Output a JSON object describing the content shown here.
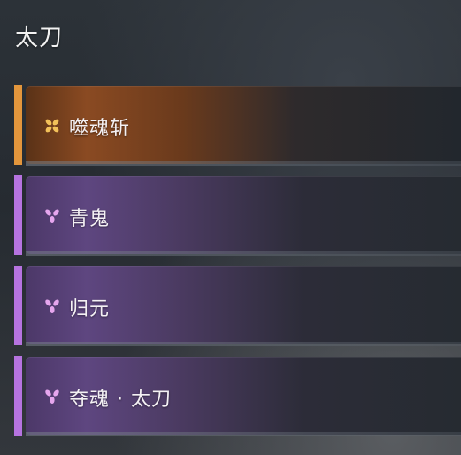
{
  "header": {
    "title": "太刀"
  },
  "skills": [
    {
      "name": "噬魂斩",
      "rarity": "orange",
      "icon": "four-petal-icon",
      "accent": "#e3963c"
    },
    {
      "name": "青鬼",
      "rarity": "purple",
      "icon": "three-petal-icon",
      "accent": "#b673e0"
    },
    {
      "name": "归元",
      "rarity": "purple",
      "icon": "three-petal-icon",
      "accent": "#b673e0"
    },
    {
      "name": "夺魂 · 太刀",
      "rarity": "purple",
      "icon": "three-petal-icon",
      "accent": "#b673e0"
    }
  ]
}
